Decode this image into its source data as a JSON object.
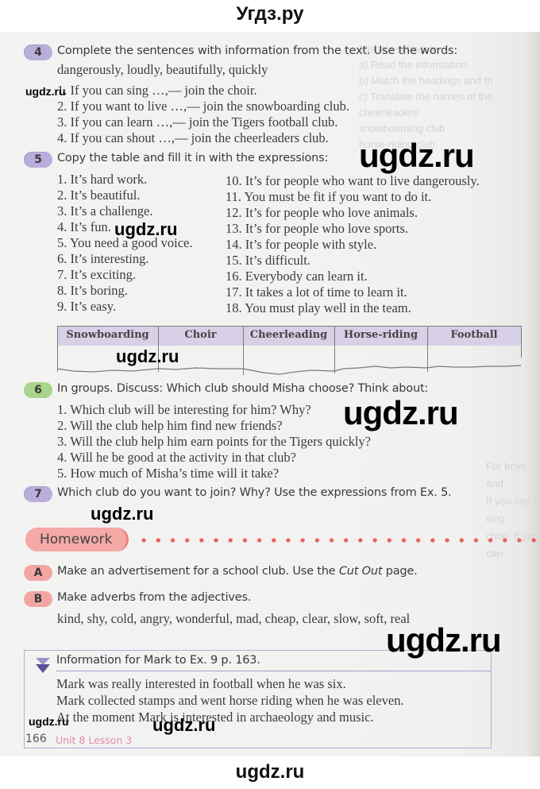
{
  "site_header": "Угдз.ру",
  "site_footer": "ugdz.ru",
  "watermarks": [
    "ugdz.ru",
    "ugdz.ru",
    "ugdz.ru",
    "ugdz.ru",
    "ugdz.ru",
    "ugdz.ru",
    "ugdz.ru",
    "ugdz.ru"
  ],
  "exercise4": {
    "number": "4",
    "instruction": "Complete the sentences with information from the text. Use the words:",
    "words": "dangerously, loudly, beautifully, quickly",
    "items": [
      "1. If you can sing …,— join the choir.",
      "2. If you want to live …,— join the snowboarding club.",
      "3. If you can learn …,— join the Tigers football club.",
      "4. If you can shout …,— join the cheerleaders club."
    ]
  },
  "exercise5": {
    "number": "5",
    "instruction": "Copy the table and fill it in with the expressions:",
    "left_column": [
      "1. It’s hard work.",
      "2. It’s beautiful.",
      "3. It’s a challenge.",
      "4. It’s fun.",
      "5. You need a good voice.",
      "6. It’s interesting.",
      "7. It’s exciting.",
      "8. It’s boring.",
      "9. It’s easy."
    ],
    "right_column": [
      "10. It’s for people who want to live dangerously.",
      "11. You must be fit if you want to do it.",
      "12. It’s for people who love animals.",
      "13. It’s for people who love sports.",
      "14. It’s for people with style.",
      "15. It’s difficult.",
      "16. Everybody can learn it.",
      "17. It takes a lot of time to learn it.",
      "18. You must play well in the team."
    ],
    "table_headers": [
      "Snowboarding",
      "Choir",
      "Cheerleading",
      "Horse-riding",
      "Football"
    ]
  },
  "exercise6": {
    "number": "6",
    "instruction": "In groups. Discuss: Which club should Misha choose? Think about:",
    "items": [
      "1. Which club will be interesting for him? Why?",
      "2. Will the club help him find new friends?",
      "3. Will the club help him earn points for the Tigers quickly?",
      "4. Will he be good at the activity in that club?",
      "5. How much of Misha’s time will it take?"
    ]
  },
  "exercise7": {
    "number": "7",
    "instruction": "Which club do you want to join? Why? Use the expressions from Ex. 5."
  },
  "homework": {
    "label": "Homework",
    "taskA": {
      "letter": "A",
      "text_before": "Make an advertisement for a school club. Use the ",
      "text_italic": "Cut Out",
      "text_after": " page."
    },
    "taskB": {
      "letter": "B",
      "text": "Make adverbs from the adjectives.",
      "words": "kind, shy, cold, angry, wonderful, mad, cheap, clear, slow, soft, real"
    }
  },
  "info_box": {
    "title": "Information for Mark to Ex. 9 p. 163.",
    "lines": [
      "Mark was really interested in football when he was six.",
      "Mark collected stamps and went horse riding when he was eleven.",
      "At the moment Mark is interested in archaeology and music."
    ]
  },
  "footer": {
    "page_number": "166",
    "unit_lesson": "Unit 8  Lesson 3"
  },
  "colors": {
    "badge_purple": "#b9aedb",
    "badge_green": "#a8d48b",
    "badge_pink": "#f2a6a2",
    "table_header": "#d8d0e6",
    "dots": "#e8605c",
    "unit_label": "#e48ab0"
  }
}
